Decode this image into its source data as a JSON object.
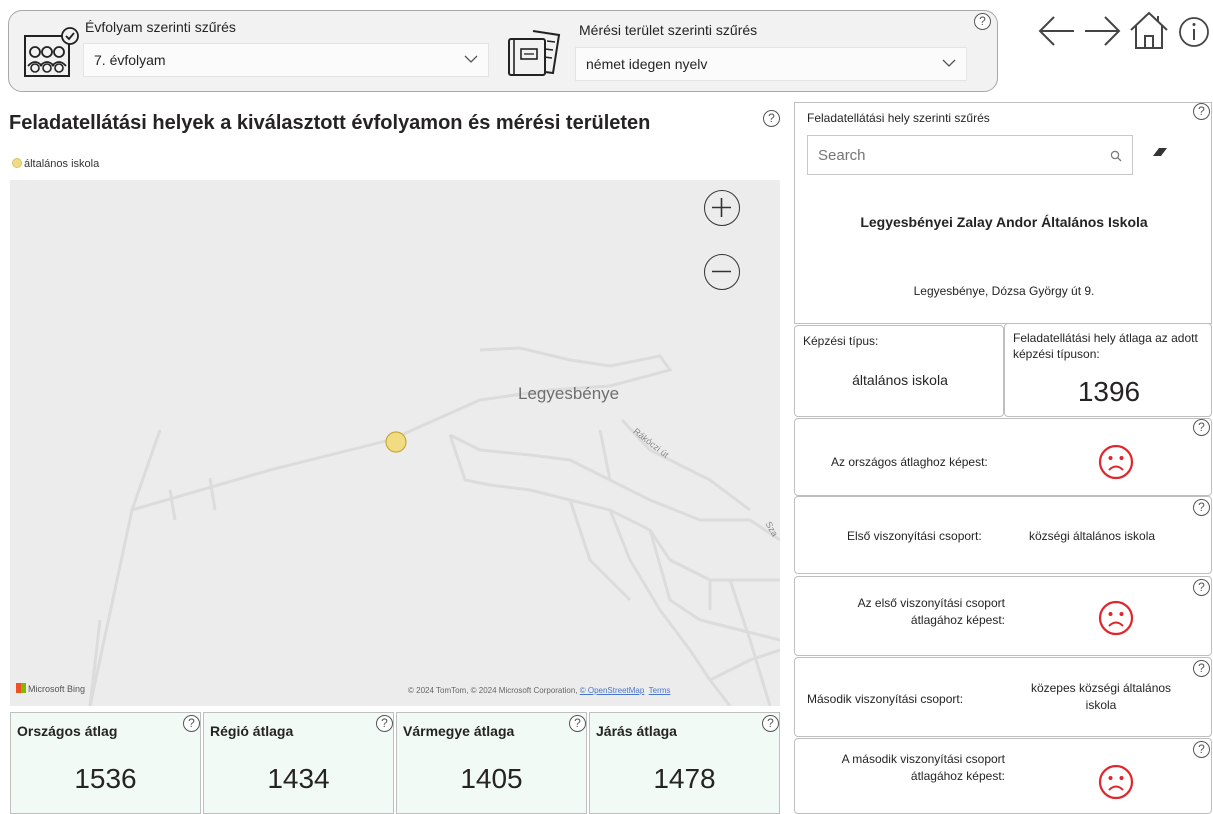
{
  "filters": {
    "grade": {
      "title": "Évfolyam szerinti szűrés",
      "value": "7. évfolyam"
    },
    "area": {
      "title": "Mérési terület szerinti szűrés",
      "value": "német idegen nyelv"
    }
  },
  "help_glyph": "?",
  "map_section": {
    "title": "Feladatellátási helyek a kiválasztott évfolyamon és mérési területen",
    "legend_label": "általános iskola",
    "place_label": "Legyesbénye",
    "street_label": "Rákóczi út",
    "street_label2": "Sza",
    "bing_label": "Microsoft Bing",
    "copyright_text": "© 2024 TomTom, © 2024 Microsoft Corporation,",
    "osm_link": "© OpenStreetMap",
    "terms_link": "Terms"
  },
  "kpis": [
    {
      "label": "Országos átlag",
      "value": "1536"
    },
    {
      "label": "Régió átlaga",
      "value": "1434"
    },
    {
      "label": "Vármegye átlaga",
      "value": "1405"
    },
    {
      "label": "Járás átlaga",
      "value": "1478"
    }
  ],
  "school_panel": {
    "filter_title": "Feladatellátási hely szerinti szűrés",
    "search_placeholder": "Search",
    "school_name": "Legyesbényei Zalay Andor Általános Iskola",
    "address": "Legyesbénye, Dózsa György út 9.",
    "training_type_label": "Képzési típus:",
    "training_type_value": "általános iskola",
    "site_avg_label": "Feladatellátási hely átlaga az adott képzési típuson:",
    "site_avg_value": "1396",
    "national_compare_label": "Az országos átlaghoz képest:",
    "first_group_label": "Első viszonyítási csoport:",
    "first_group_value": "községi általános iskola",
    "first_group_compare_label": "Az első viszonyítási csoport átlagához képest:",
    "second_group_label": "Második viszonyítási csoport:",
    "second_group_value": "közepes községi általános iskola",
    "second_group_compare_label": "A második viszonyítási csoport átlagához képest:"
  },
  "colors": {
    "sad_face": "#e0262c",
    "kpi_bg": "#f1faf5",
    "marker": "#f2dc83"
  }
}
